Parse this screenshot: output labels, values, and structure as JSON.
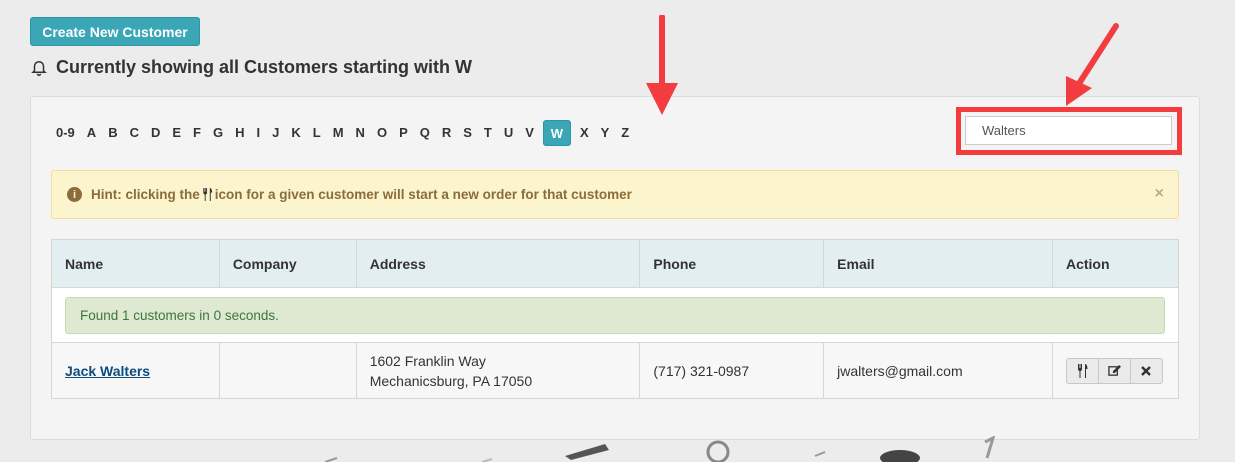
{
  "header": {
    "create_button": "Create New Customer",
    "showing_text": "Currently showing all Customers starting with W"
  },
  "letters": [
    "0-9",
    "A",
    "B",
    "C",
    "D",
    "E",
    "F",
    "G",
    "H",
    "I",
    "J",
    "K",
    "L",
    "M",
    "N",
    "O",
    "P",
    "Q",
    "R",
    "S",
    "T",
    "U",
    "V",
    "W",
    "X",
    "Y",
    "Z"
  ],
  "active_letter": "W",
  "search": {
    "value": "Walters"
  },
  "hint": {
    "text_before": "Hint: clicking the",
    "text_after": "icon for a given customer will start a new order for that customer",
    "close": "×"
  },
  "table": {
    "headers": [
      "Name",
      "Company",
      "Address",
      "Phone",
      "Email",
      "Action"
    ],
    "found_message": "Found 1 customers in 0 seconds.",
    "rows": [
      {
        "name": "Jack Walters",
        "company": "",
        "address_line1": "1602 Franklin Way",
        "address_line2": "Mechanicsburg, PA 17050",
        "phone": "(717) 321-0987",
        "email": "jwalters@gmail.com"
      }
    ]
  },
  "colors": {
    "accent": "#3aa6b6",
    "annotation": "#f23c40",
    "hint_bg": "#fcf4cc",
    "success_bg": "#dfe9d2"
  }
}
